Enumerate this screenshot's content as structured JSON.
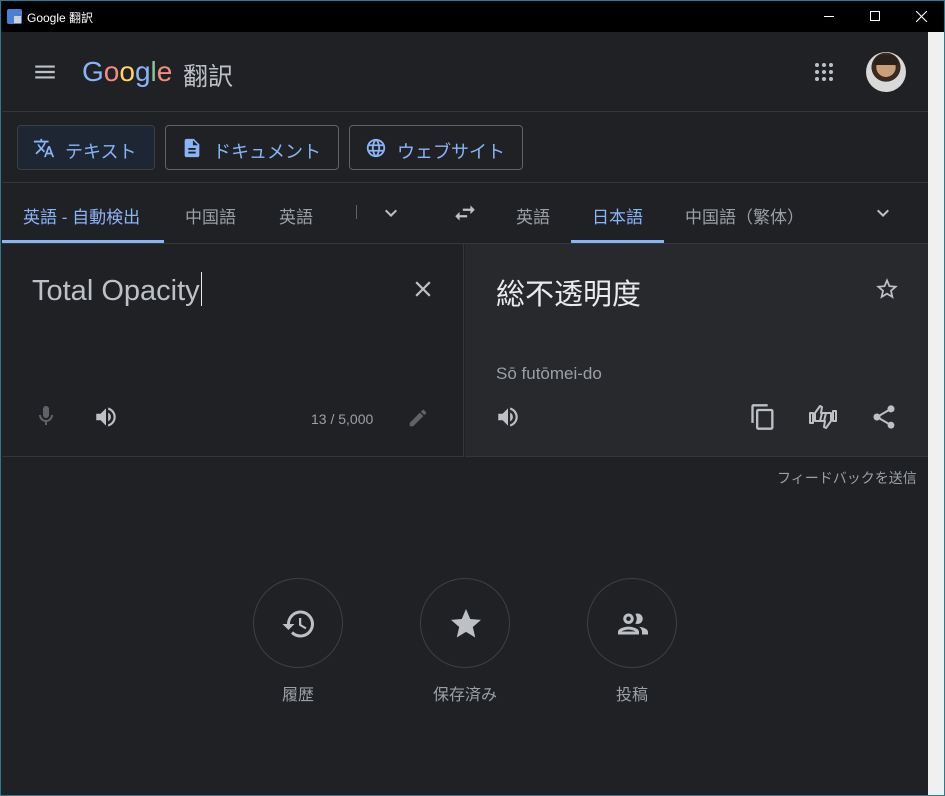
{
  "window": {
    "title": "Google 翻訳"
  },
  "header": {
    "logo_letters": [
      "G",
      "o",
      "o",
      "g",
      "l",
      "e"
    ],
    "logo_suffix": "翻訳",
    "icons": {
      "menu": "menu-icon",
      "apps": "apps-grid-icon",
      "avatar": "user-avatar"
    }
  },
  "modes": [
    {
      "label": "テキスト",
      "icon": "translate-icon",
      "active": true
    },
    {
      "label": "ドキュメント",
      "icon": "document-icon",
      "active": false
    },
    {
      "label": "ウェブサイト",
      "icon": "globe-icon",
      "active": false
    }
  ],
  "source_langs": [
    {
      "label": "英語 - 自動検出",
      "active": true
    },
    {
      "label": "中国語",
      "active": false
    },
    {
      "label": "英語",
      "active": false
    }
  ],
  "target_langs": [
    {
      "label": "英語",
      "active": false
    },
    {
      "label": "日本語",
      "active": true
    },
    {
      "label": "中国語（繁体）",
      "active": false
    }
  ],
  "source": {
    "text": "Total Opacity",
    "counter": "13 / 5,000"
  },
  "target": {
    "text": "総不透明度",
    "romanization": "Sō futōmei-do"
  },
  "feedback_label": "フィードバックを送信",
  "actions": [
    {
      "label": "履歴",
      "icon": "history-icon"
    },
    {
      "label": "保存済み",
      "icon": "star-icon"
    },
    {
      "label": "投稿",
      "icon": "people-icon"
    }
  ],
  "colors": {
    "accent": "#8ab4f8",
    "background": "#202124",
    "panel": "#28292c",
    "text": "#bdc1c6"
  }
}
